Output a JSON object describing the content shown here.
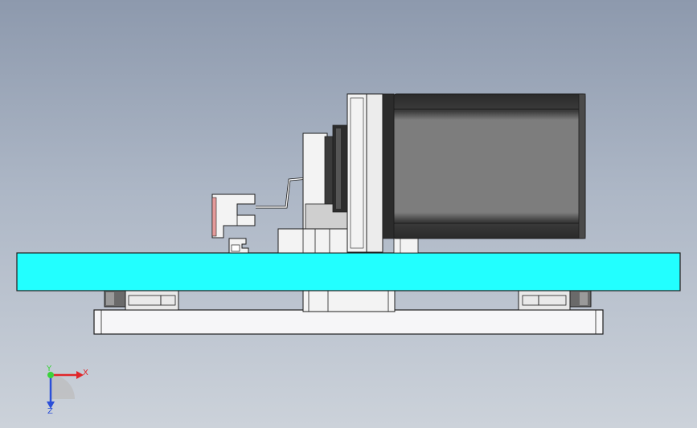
{
  "viewport": {
    "background_top": "#8d99ad",
    "background_bottom": "#ccd2da"
  },
  "colors": {
    "table_plate": "#22ffff",
    "base_plate": "#f6f6f8",
    "motor_body": "#7a7a7a",
    "motor_dark": "#2b2b2b",
    "part_light": "#f3f3f3",
    "part_mid": "#cfcfcf",
    "outline": "#1e1e1e",
    "axis_x": "#e0262a",
    "axis_y": "#3ad23a",
    "axis_z": "#2b4fd8"
  },
  "triad": {
    "x_label": "X",
    "y_label": "Y",
    "z_label": "Z"
  },
  "icons": [
    "coordinate-triad-icon"
  ]
}
